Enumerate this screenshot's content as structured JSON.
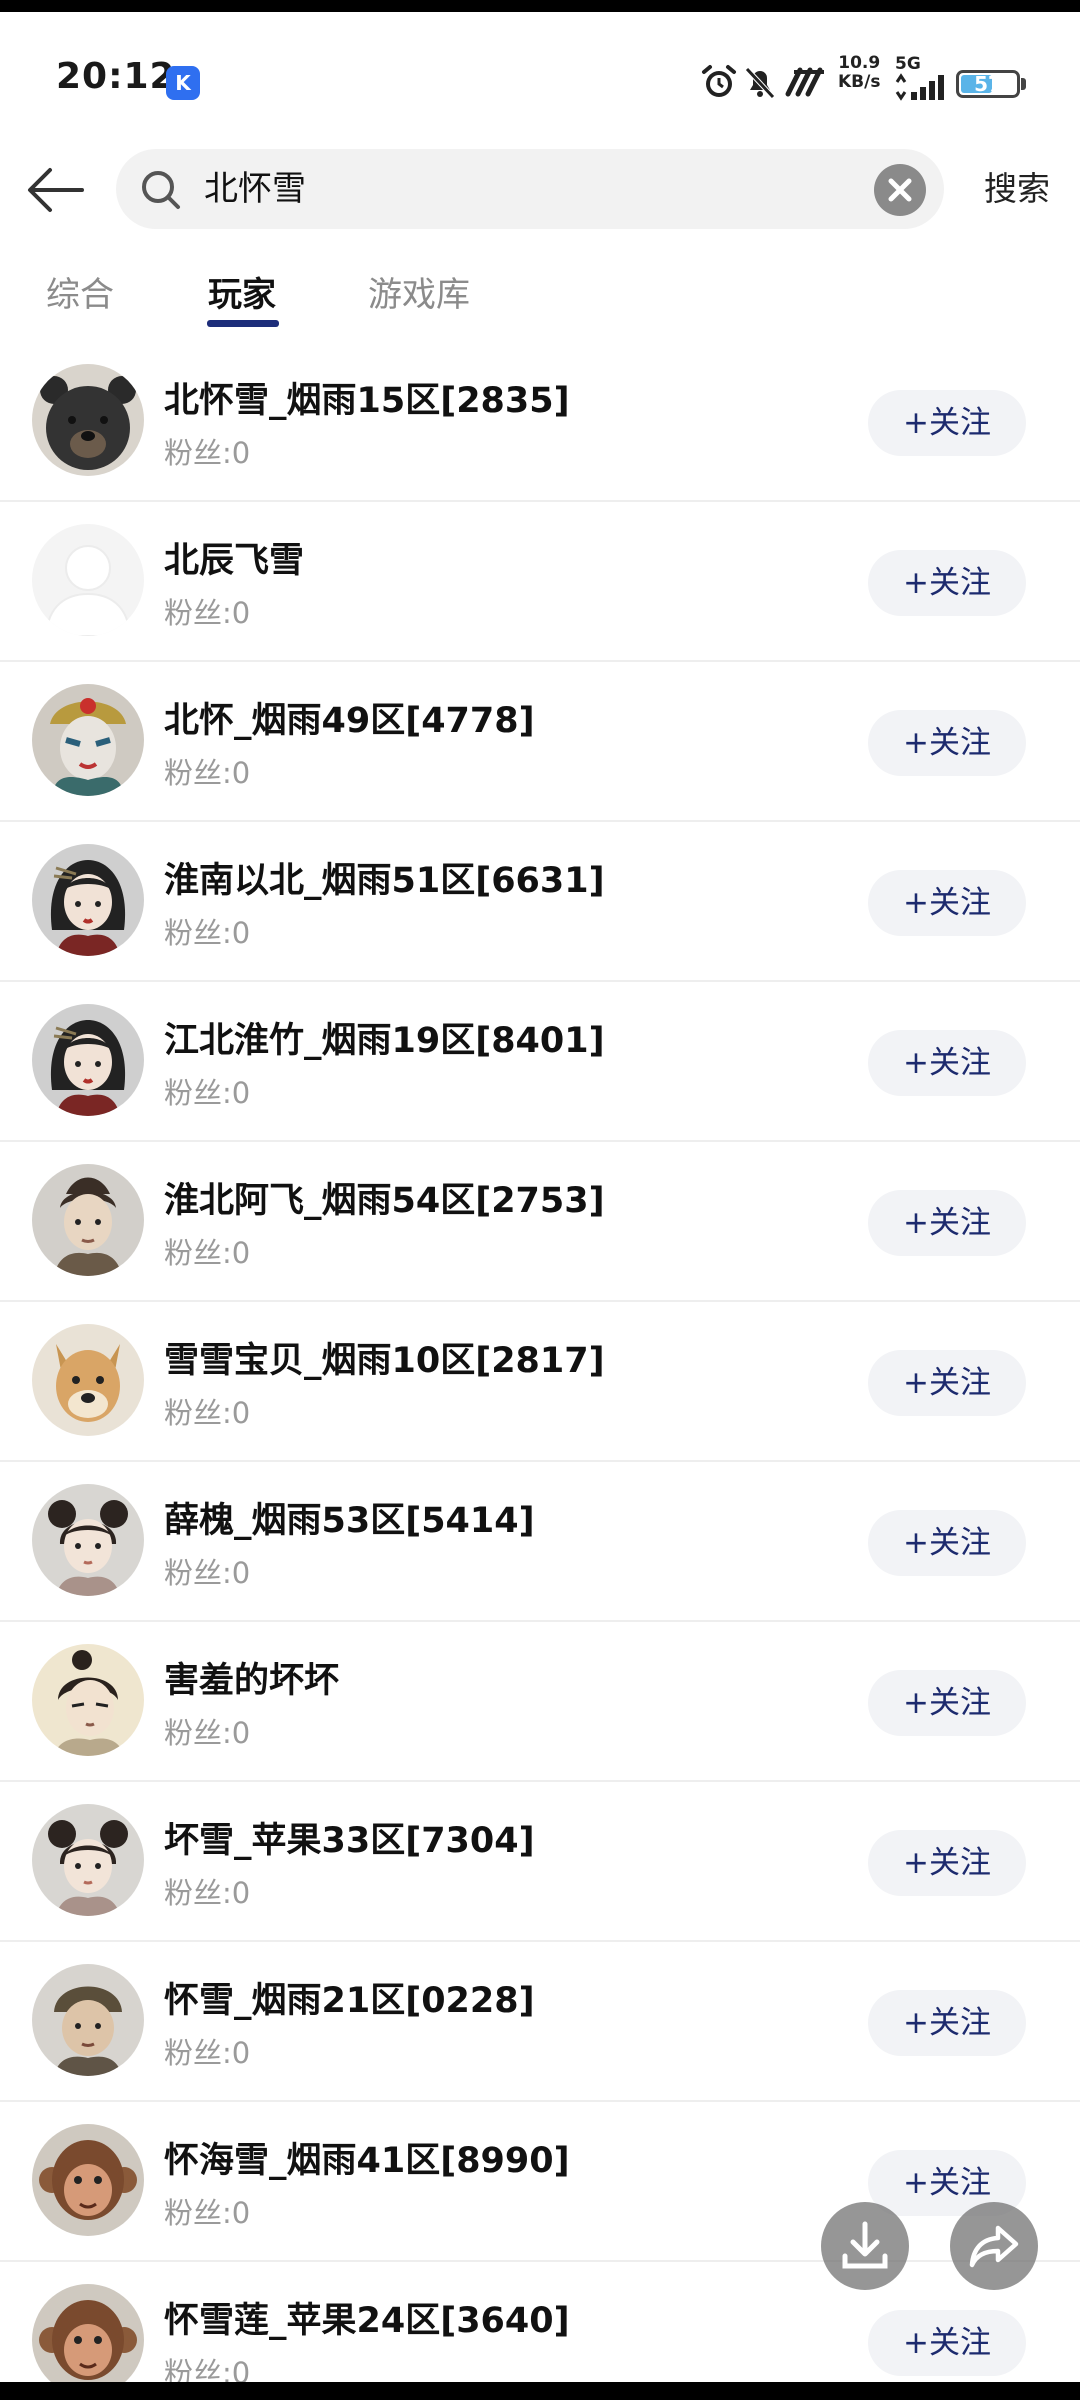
{
  "status_bar": {
    "time": "20:12",
    "app_badge": "K",
    "net_speed_value": "10.9",
    "net_speed_unit": "KB/s",
    "network": "5G",
    "battery": "57"
  },
  "header": {
    "search_query": "北怀雪",
    "search_label": "搜索"
  },
  "tabs": [
    {
      "label": "综合"
    },
    {
      "label": "玩家"
    },
    {
      "label": "游戏库"
    }
  ],
  "active_tab": "玩家",
  "results": [
    {
      "name": "北怀雪_烟雨15区[2835]",
      "fans": "粉丝:0",
      "follow": "+关注",
      "avatar": "bear"
    },
    {
      "name": "北辰飞雪",
      "fans": "粉丝:0",
      "follow": "+关注",
      "avatar": "default"
    },
    {
      "name": "北怀_烟雨49区[4778]",
      "fans": "粉丝:0",
      "follow": "+关注",
      "avatar": "opera-mask"
    },
    {
      "name": "淮南以北_烟雨51区[6631]",
      "fans": "粉丝:0",
      "follow": "+关注",
      "avatar": "woman-hairpin"
    },
    {
      "name": "江北淮竹_烟雨19区[8401]",
      "fans": "粉丝:0",
      "follow": "+关注",
      "avatar": "woman-hairpin"
    },
    {
      "name": "淮北阿飞_烟雨54区[2753]",
      "fans": "粉丝:0",
      "follow": "+关注",
      "avatar": "young-man"
    },
    {
      "name": "雪雪宝贝_烟雨10区[2817]",
      "fans": "粉丝:0",
      "follow": "+关注",
      "avatar": "dog"
    },
    {
      "name": "薛槐_烟雨53区[5414]",
      "fans": "粉丝:0",
      "follow": "+关注",
      "avatar": "girl-buns"
    },
    {
      "name": "害羞的坏坏",
      "fans": "粉丝:0",
      "follow": "+关注",
      "avatar": "man-topknot"
    },
    {
      "name": "坏雪_苹果33区[7304]",
      "fans": "粉丝:0",
      "follow": "+关注",
      "avatar": "girl-buns"
    },
    {
      "name": "怀雪_烟雨21区[0228]",
      "fans": "粉丝:0",
      "follow": "+关注",
      "avatar": "boy-hat"
    },
    {
      "name": "怀海雪_烟雨41区[8990]",
      "fans": "粉丝:0",
      "follow": "+关注",
      "avatar": "monkey"
    },
    {
      "name": "怀雪莲_苹果24区[3640]",
      "fans": "粉丝:0",
      "follow": "+关注",
      "avatar": "monkey"
    }
  ],
  "floating_actions": [
    "download-icon",
    "share-icon"
  ]
}
